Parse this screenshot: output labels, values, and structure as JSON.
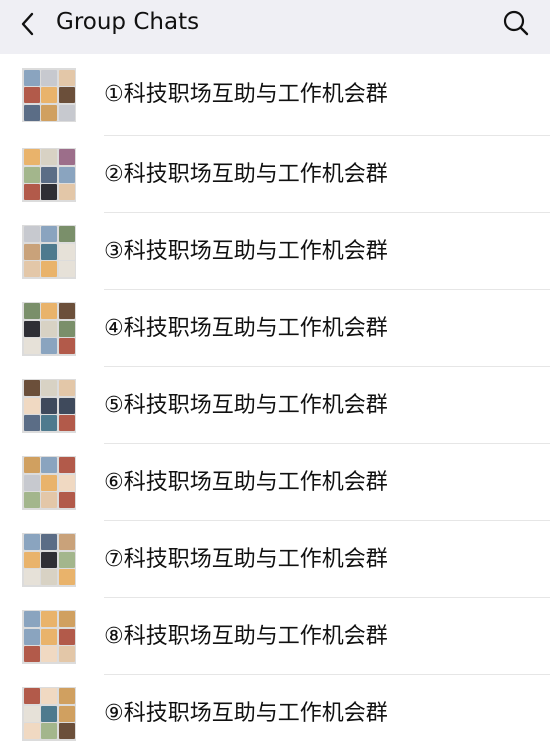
{
  "header": {
    "back_icon": "chevron-left-icon",
    "title": "Group Chats",
    "search_icon": "search-icon"
  },
  "groups": [
    {
      "name": "①科技职场互助与工作机会群"
    },
    {
      "name": "②科技职场互助与工作机会群"
    },
    {
      "name": "③科技职场互助与工作机会群"
    },
    {
      "name": "④科技职场互助与工作机会群"
    },
    {
      "name": "⑤科技职场互助与工作机会群"
    },
    {
      "name": "⑥科技职场互助与工作机会群"
    },
    {
      "name": "⑦科技职场互助与工作机会群"
    },
    {
      "name": "⑧科技职场互助与工作机会群"
    },
    {
      "name": "⑨科技职场互助与工作机会群"
    }
  ],
  "colors": {
    "header_bg": "#efeff4",
    "text": "#111111",
    "divider": "#e6e6e6"
  }
}
